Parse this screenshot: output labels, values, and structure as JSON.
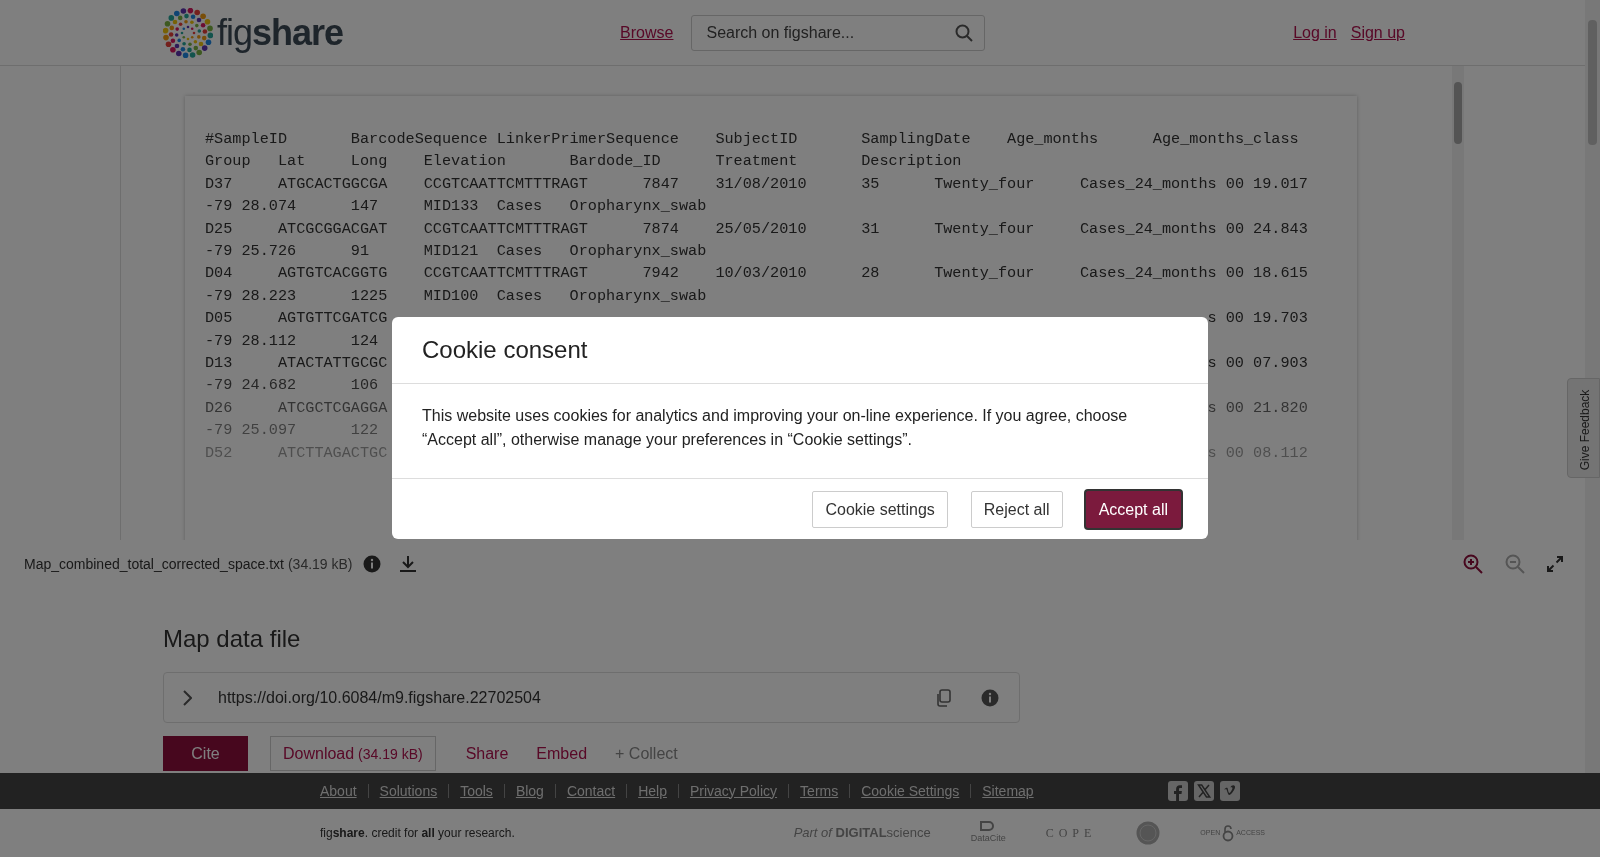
{
  "header": {
    "logo": "fig**share**",
    "nav": [
      {
        "label": "Browse"
      }
    ],
    "search": {
      "placeholder": "Search on figshare..."
    },
    "auth": [
      {
        "label": "Log in"
      },
      {
        "label": "Sign up"
      }
    ]
  },
  "preview": {
    "lines": [
      {
        "kind": "full",
        "text": "#SampleID\tBarcodeSequence LinkerPrimerSequence\tSubjectID\tSamplingDate\tAge_months\tAge_months_class"
      },
      {
        "kind": "full",
        "text": "Group\tLat\tLong\tElevation\tBardode_ID\tTreatment\tDescription"
      },
      {
        "kind": "full",
        "text": "D37\tATGCACTGGCGA\tCCGTCAATTCMTTTRAGT\t7847\t31/08/2010\t35\tTwenty_four\tCases_24_months 00 19.017"
      },
      {
        "kind": "full",
        "text": "-79 28.074\t147\tMID133\tCases\tOropharynx_swab"
      },
      {
        "kind": "full",
        "text": "D25\tATCGCGGACGAT\tCCGTCAATTCMTTTRAGT\t7874\t25/05/2010\t31\tTwenty_four\tCases_24_months 00 24.843"
      },
      {
        "kind": "full",
        "text": "-79 25.726\t91\tMID121\tCases\tOropharynx_swab"
      },
      {
        "kind": "full",
        "text": "D04\tAGTGTCACGGTG\tCCGTCAATTCMTTTRAGT\t7942\t10/03/2010\t28\tTwenty_four\tCases_24_months 00 18.615"
      },
      {
        "kind": "full",
        "text": "-79 28.223\t1225\tMID100\tCases\tOropharynx_swab"
      },
      {
        "kind": "split",
        "left": "D05\tAGTGTTCGATCG",
        "right": "s 00 19.703"
      },
      {
        "kind": "split",
        "left": "-79 28.112\t124"
      },
      {
        "kind": "split",
        "left": "D13\tATACTATTGCGC",
        "right": "s 00 07.903"
      },
      {
        "kind": "split",
        "left": "-79 24.682\t106"
      },
      {
        "kind": "split",
        "left": "D26\tATCGCTCGAGGA",
        "right": "s 00 21.820"
      },
      {
        "kind": "split",
        "left": "-79 25.097\t122"
      },
      {
        "kind": "split",
        "left": "D52\tATCTTAGACTGC",
        "right": "s 00 08.112"
      }
    ]
  },
  "file_bar": {
    "filename": "Map_combined_total_corrected_space.txt",
    "size": "(34.19 kB)",
    "tools": [
      {
        "kind": "zoom-in",
        "disabled": false
      },
      {
        "kind": "zoom-out",
        "disabled": true
      },
      {
        "kind": "expand",
        "disabled": false
      }
    ]
  },
  "item": {
    "title": "Map data file",
    "doi": "https://doi.org/10.6084/m9.figshare.22702504",
    "actions": [
      {
        "kind": "primary",
        "label": "Cite"
      },
      {
        "kind": "outline",
        "label": "Download",
        "note": "(34.19 kB)"
      },
      {
        "kind": "link",
        "label": "Share"
      },
      {
        "kind": "link",
        "label": "Embed"
      },
      {
        "kind": "muted",
        "label": "+ Collect"
      }
    ]
  },
  "footer": {
    "links": [
      "About",
      "Solutions",
      "Tools",
      "Blog",
      "Contact",
      "Help",
      "Privacy Policy",
      "Terms",
      "Cookie Settings",
      "Sitemap"
    ],
    "social": [
      {
        "kind": "facebook"
      },
      {
        "kind": "x"
      },
      {
        "kind": "vimeo"
      }
    ],
    "credit": "fig**share**. credit for **all** your research.",
    "partners": [
      {
        "kind": "digital-science",
        "text": "*Part of* **DIGITAL**science"
      },
      {
        "kind": "datacite",
        "text": "DataCite"
      },
      {
        "kind": "cope",
        "text": "COPE"
      },
      {
        "kind": "seal"
      },
      {
        "kind": "open-access",
        "text": "OPEN",
        "text2": "ACCESS"
      }
    ]
  },
  "feedback_tab": {
    "label": "Give Feedback"
  },
  "cookie_modal": {
    "title": "Cookie consent",
    "body": "This website uses cookies for analytics and improving your on-line experience. If you agree, choose “Accept all”, otherwise manage your preferences in “Cookie settings”.",
    "buttons": [
      {
        "kind": "secondary",
        "label": "Cookie settings",
        "focused": false
      },
      {
        "kind": "secondary",
        "label": "Reject all",
        "focused": false
      },
      {
        "kind": "primary",
        "label": "Accept all",
        "focused": true
      }
    ]
  }
}
